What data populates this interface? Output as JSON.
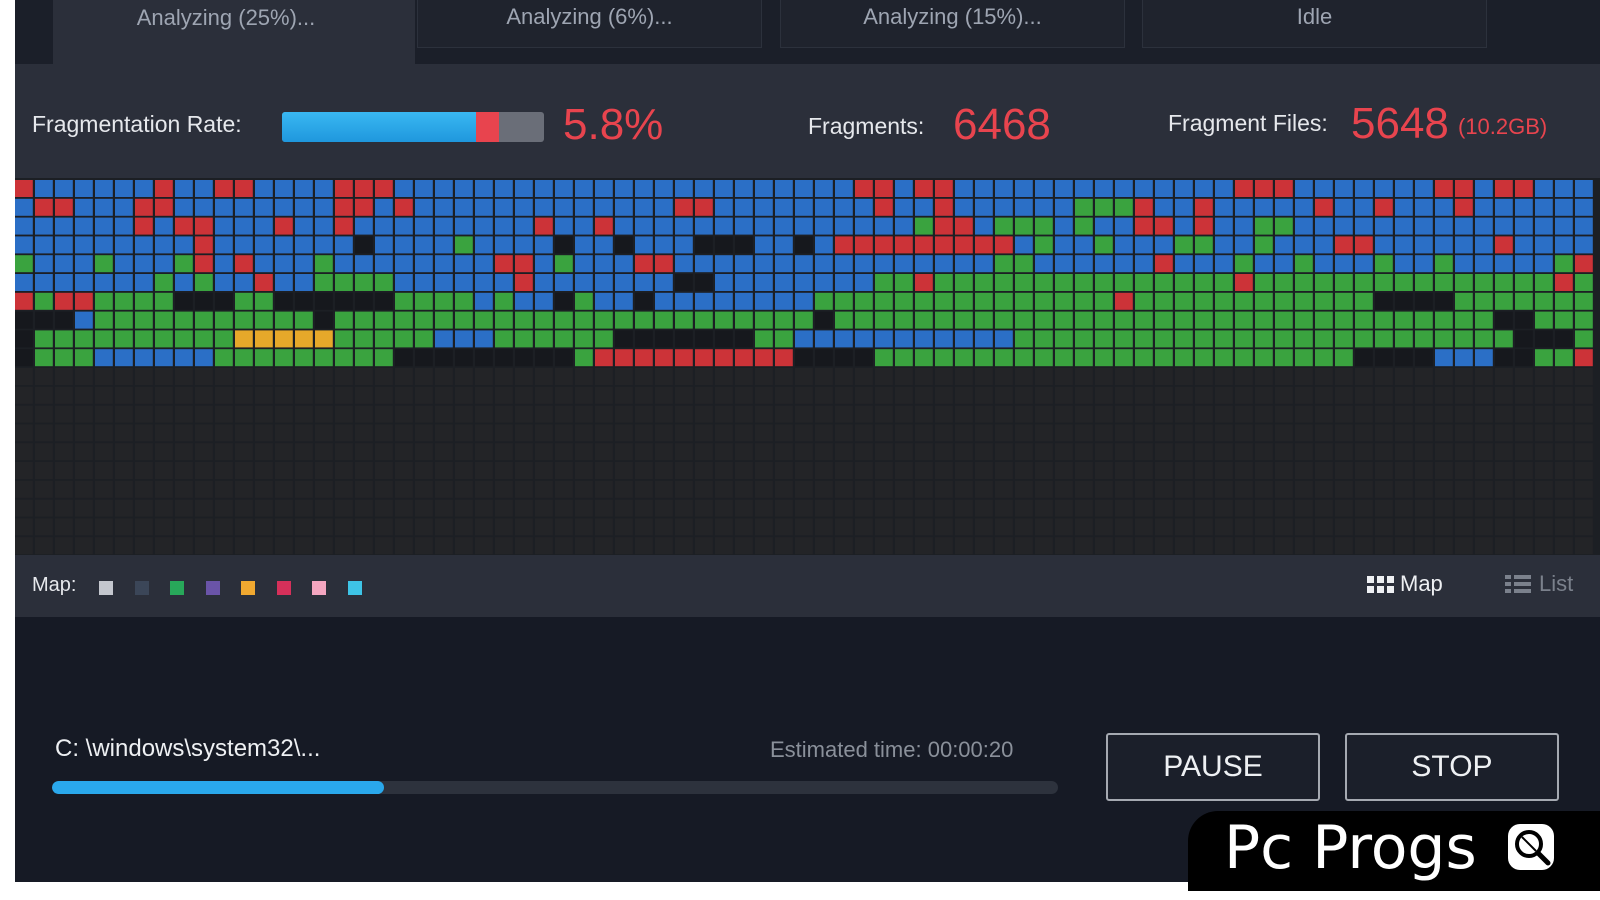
{
  "tabs": [
    {
      "label": "Analyzing (25%)...",
      "active": true
    },
    {
      "label": "Analyzing (6%)...",
      "active": false
    },
    {
      "label": "Analyzing (15%)...",
      "active": false
    },
    {
      "label": "Idle",
      "active": false
    }
  ],
  "stats": {
    "fragmentation_label": "Fragmentation Rate:",
    "fragmentation_value": "5.8%",
    "fragmentation_bar": {
      "blue_fraction": 0.74,
      "red_fraction": 0.09
    },
    "fragments_label": "Fragments:",
    "fragments_value": "6468",
    "fragment_files_label": "Fragment Files:",
    "fragment_files_value": "5648",
    "fragment_files_size": "(10.2GB)"
  },
  "map_grid": {
    "columns": 79,
    "rows": 20,
    "filled_rows": 10,
    "colors": {
      "B": "#2b6fc6",
      "R": "#cc3338",
      "G": "#3aa33f",
      "K": "#16181d",
      "Y": "#e6a82a",
      "E": "#232427"
    },
    "rows_pattern": [
      "RBBBBBBRBBRRBBBBRRRBBBBBBBBBBBBBBBBBBBBBBBRRBRRBBBBBBBBBBBBBBRRRBBBBBBBRRBRRBBBBBBB",
      "BRRBBBRRBBBBBBBBRRBRBBBBBBBBBBBBBRRBBBBBBBBRBBRBBBBBBGGGRBBRBBBBBRBBRBBBRBBBBBBBB",
      "BBBBBBRBRRBBBRBBRBBBBBBBBBRBBRBBBBBBBBBBBBBBBGRRBGGGBGBBRRBRBBGGBBBBBBBBBBBBBBBBB",
      "BBBBBBBBBRBBBBBBBKBBBBGBBBBKBBKBBBKKKBBKBRRRRRRRRRBGBBGBBBGGBBGBBBRRBBBBBBRBBBBBB",
      "GBBBGBBBGRBRBBBGBBBBBBBBRRBGBBBRRBBBBBBBBBBBBBBBBGGBBBBBBRBBBGBBGBBBGBBGBBBBBGRRB",
      "BBBBBBBGBGBBRBBGGGGBBBBBBRBBBBBBBKKBBBBBBBBGGRGGGGGGGGGGGGGGGRGGGGGGGGGGGGGGGRGGB",
      "RGRRGGGGKKKGGKKKKKKGGGGBGBBKGBBKBBBBBBBBGGGGGGGGGGGGGGGRGGGGGGGGGGGGKKKKGGGGGGGGG",
      "KKKBGGGGGGGGGGGKGGGGGGGGGGGGGGGGGGGGGGGGKGGGGGGGGGGGGGGGGGGGGGGGGGGGGGGGGGKKGGGGG",
      "KGGGGGGGGGGYYYYYGGGGGBBBGGGGGGKKKKKKKGGBBBBBBBBBBBGGGGGGGGGGGGGGGGGGGGGGGGGKKKGGG",
      "KGGGBBBBBBGGGGGGGGGKKKKKKKKKGRRRRRRRRRRKKKKGGGGGGGGGGGGGGGGGGGGGGGGKKKKBBBKKGGRRR"
    ]
  },
  "legend": {
    "label": "Map:",
    "swatches": [
      "#c4c7ce",
      "#3b4658",
      "#28a85a",
      "#6a54a8",
      "#f0a830",
      "#d6305a",
      "#f4a6c0",
      "#3ec4e6"
    ],
    "map_view_label": "Map",
    "list_view_label": "List"
  },
  "bottom": {
    "current_path": "C: \\windows\\system32\\...",
    "estimated_time": "Estimated time: 00:00:20",
    "progress_fraction": 0.33,
    "pause_label": "PAUSE",
    "stop_label": "STOP"
  },
  "watermark": {
    "text": "Pc Progs"
  },
  "icons": {
    "map_view": "grid-icon",
    "list_view": "list-icon",
    "watermark": "magnifier-icon"
  }
}
